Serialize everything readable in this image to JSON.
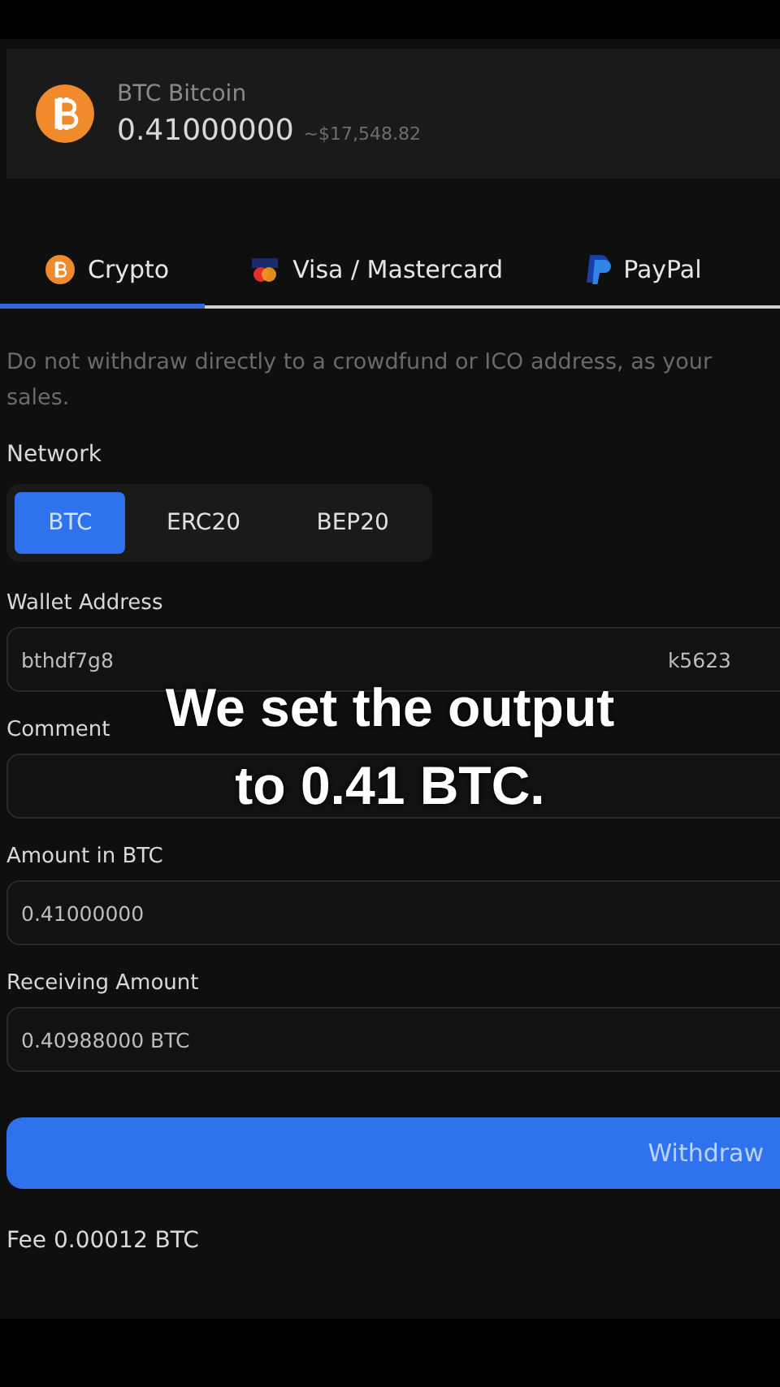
{
  "asset": {
    "symbol_name": "BTC Bitcoin",
    "balance": "0.41000000",
    "fiat": "~$17,548.82"
  },
  "tabs": [
    {
      "label": "Crypto",
      "kind": "crypto",
      "selected": true
    },
    {
      "label": "Visa / Mastercard",
      "kind": "card",
      "selected": false
    },
    {
      "label": "PayPal",
      "kind": "paypal",
      "selected": false
    }
  ],
  "warning": [
    "Do not withdraw directly to a crowdfund or ICO address, as your",
    "sales."
  ],
  "network": {
    "label": "Network",
    "options": [
      {
        "label": "BTC",
        "selected": true
      },
      {
        "label": "ERC20",
        "selected": false
      },
      {
        "label": "BEP20",
        "selected": false
      }
    ]
  },
  "fields": [
    {
      "label": "Wallet Address",
      "value_start": "bthdf7g8",
      "value_end": "k5623"
    },
    {
      "label": "Comment"
    },
    {
      "label": "Amount in BTC",
      "value": "0.41000000"
    },
    {
      "label": "Receiving Amount",
      "value": "0.40988000 BTC"
    }
  ],
  "withdraw_button": "Withdraw",
  "fee": "Fee 0.00012 BTC",
  "caption": [
    "We set the output",
    "to 0.41 BTC."
  ]
}
